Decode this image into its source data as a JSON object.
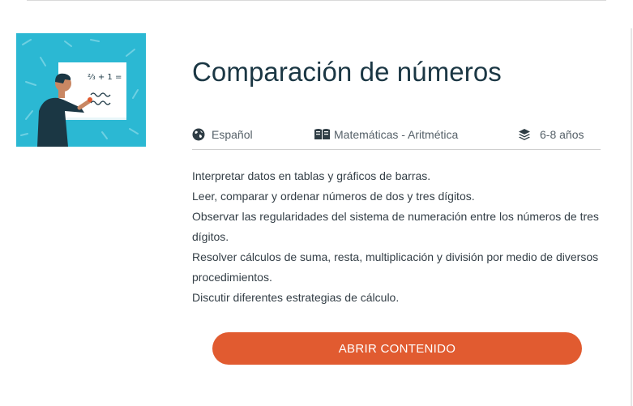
{
  "card": {
    "title": "Comparación de números",
    "thumbnail": {
      "board_formula": "⅔ + 1 ="
    },
    "meta": {
      "language": {
        "icon": "globe-icon",
        "label": "Español"
      },
      "subject": {
        "icon": "book-icon",
        "label": "Matemáticas - Aritmética"
      },
      "age": {
        "icon": "layers-icon",
        "label": "6-8 años"
      }
    },
    "description": [
      "Interpretar datos en tablas y gráficos de barras.",
      "Leer, comparar y ordenar números de dos y tres dígitos.",
      "Observar las regularidades del sistema de numeración entre los números de tres dígitos.",
      "Resolver cálculos de suma, resta, multiplicación y división por medio de diversos procedimientos.",
      "Discutir diferentes estrategias de cálculo."
    ],
    "cta_label": "ABRIR CONTENIDO"
  },
  "colors": {
    "accent": "#e15b30",
    "title": "#1b3744",
    "thumbnail_bg": "#2bb8d3"
  }
}
